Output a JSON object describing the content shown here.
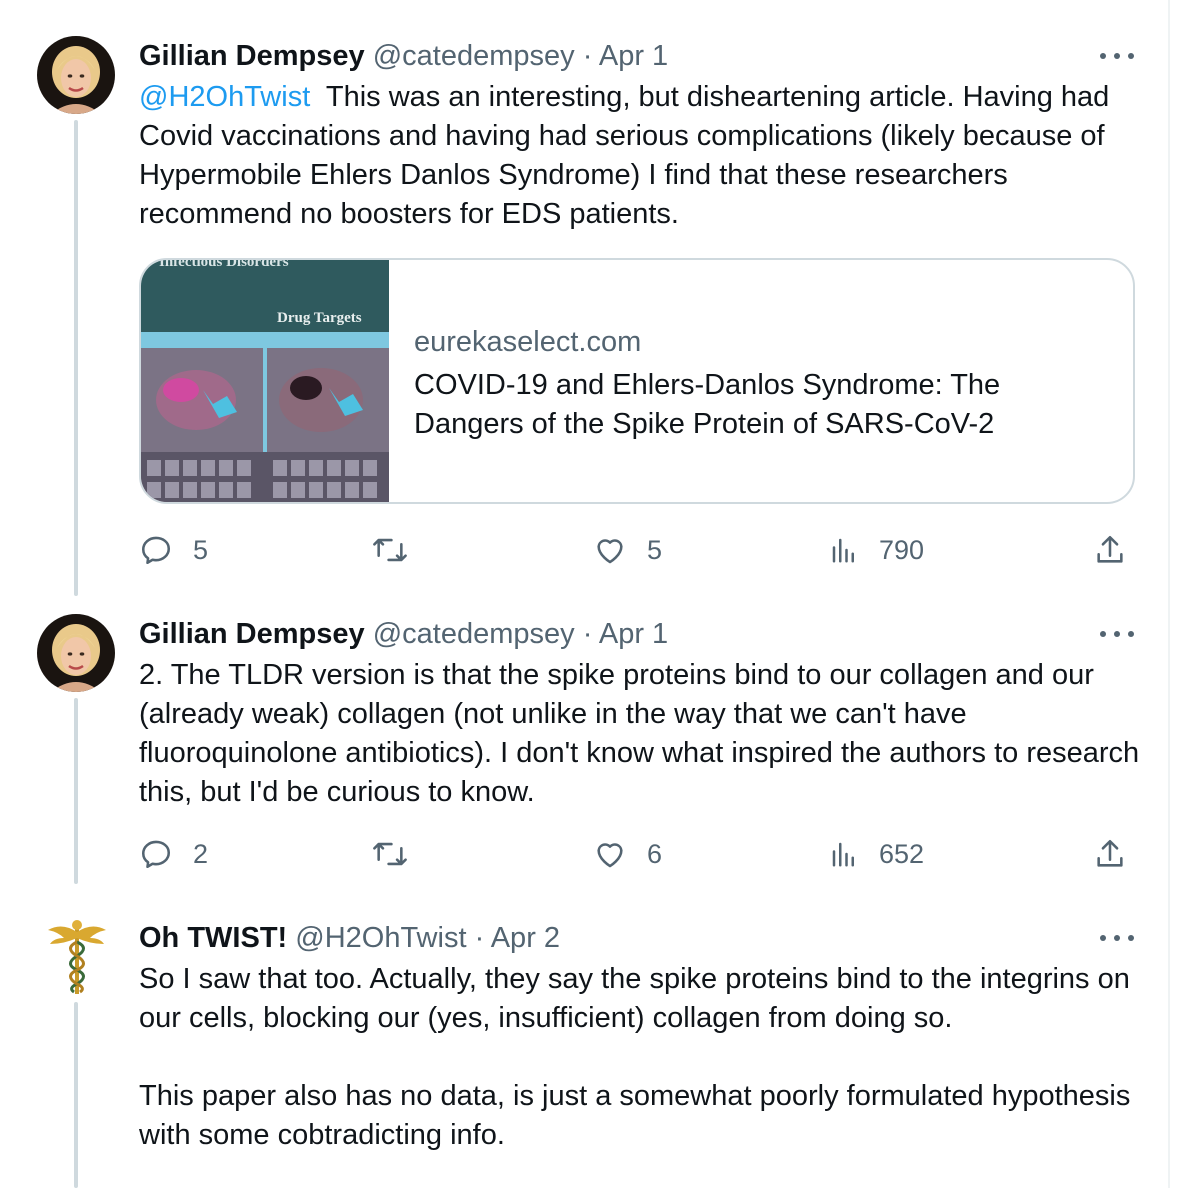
{
  "tweets": [
    {
      "name": "Gillian Dempsey",
      "handle": "@catedempsey",
      "separator": "·",
      "date": "Apr 1",
      "mention": "@H2OhTwist",
      "text": "  This was an interesting, but disheartening article. Having had Covid vaccinations and having had serious complications (likely because of Hypermobile Ehlers Danlos Syndrome) I find that these researchers recommend no boosters for EDS patients.",
      "card": {
        "domain": "eurekaselect.com",
        "title": "COVID-19 and Ehlers-Danlos Syndrome: The Dangers of the Spike Protein of SARS-CoV-2",
        "image_header": "Infectious Disorders",
        "image_sub": "Drug Targets"
      },
      "stats": {
        "replies": "5",
        "likes": "5",
        "views": "790"
      }
    },
    {
      "name": "Gillian Dempsey",
      "handle": "@catedempsey",
      "separator": "·",
      "date": "Apr 1",
      "text": "2. The TLDR version is that the spike proteins bind to our collagen and our (already weak) collagen (not unlike in the way that we can't have fluoroquinolone antibiotics). I don't know what inspired the authors to research this, but I'd be curious to know.",
      "stats": {
        "replies": "2",
        "likes": "6",
        "views": "652"
      }
    },
    {
      "name": "Oh TWIST!",
      "handle": "@H2OhTwist",
      "separator": "·",
      "date": "Apr 2",
      "text": "So I saw that too. Actually, they say the spike proteins bind to the integrins on our cells, blocking our (yes, insufficient) collagen from doing so.\n\nThis paper also has no data, is just a somewhat poorly formulated hypothesis with some cobtradicting info."
    }
  ],
  "icons": {
    "reply": "reply-icon",
    "retweet": "retweet-icon",
    "like": "like-icon",
    "views": "views-icon",
    "share": "share-icon",
    "more": "more-icon"
  },
  "colors": {
    "link": "#1d9bf0",
    "secondary": "#536471",
    "border": "#cfd9de"
  }
}
